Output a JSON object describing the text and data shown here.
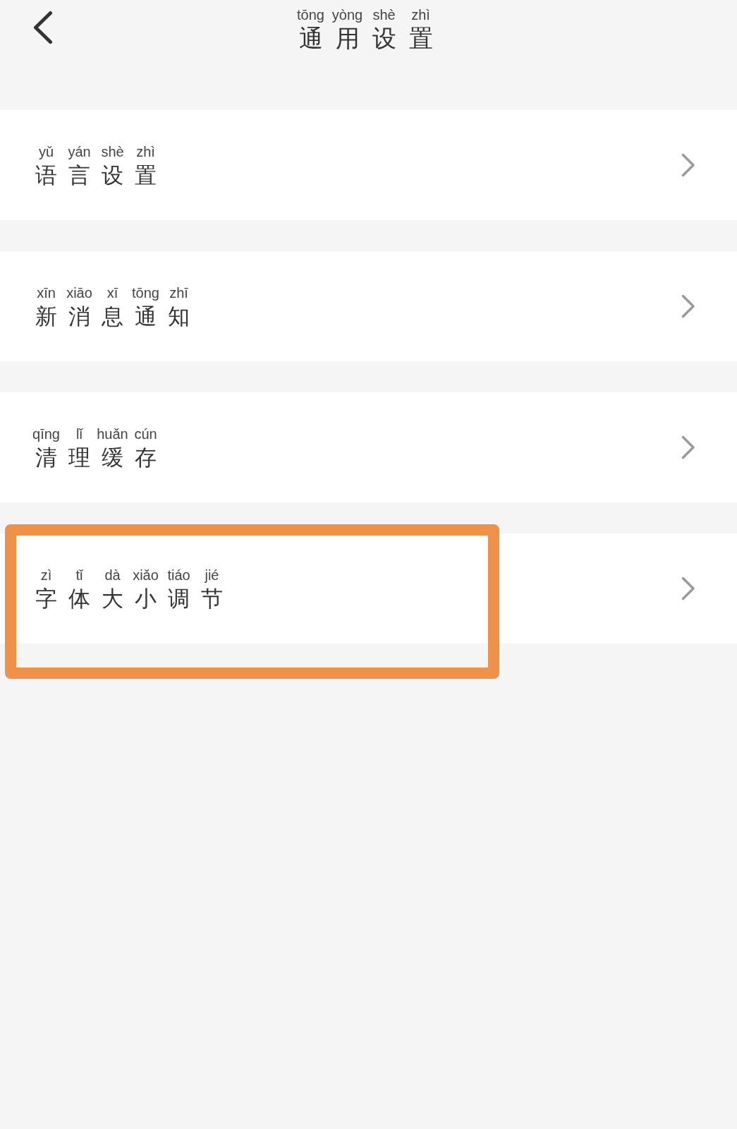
{
  "header": {
    "title_pinyin": "tōng yòng shè zhì",
    "title": "通用设置"
  },
  "items": [
    {
      "pinyin": "yǔ yán shè zhì",
      "label": "语言设置",
      "highlighted": false
    },
    {
      "pinyin": "xīn xiāo xī tōng zhī",
      "label": "新消息通知",
      "highlighted": false
    },
    {
      "pinyin": "qīng lǐ huǎn cún",
      "label": "清理缓存",
      "highlighted": false
    },
    {
      "pinyin": "zì tǐ dà xiǎo tiáo jié",
      "label": "字体大小调节",
      "highlighted": true
    }
  ]
}
